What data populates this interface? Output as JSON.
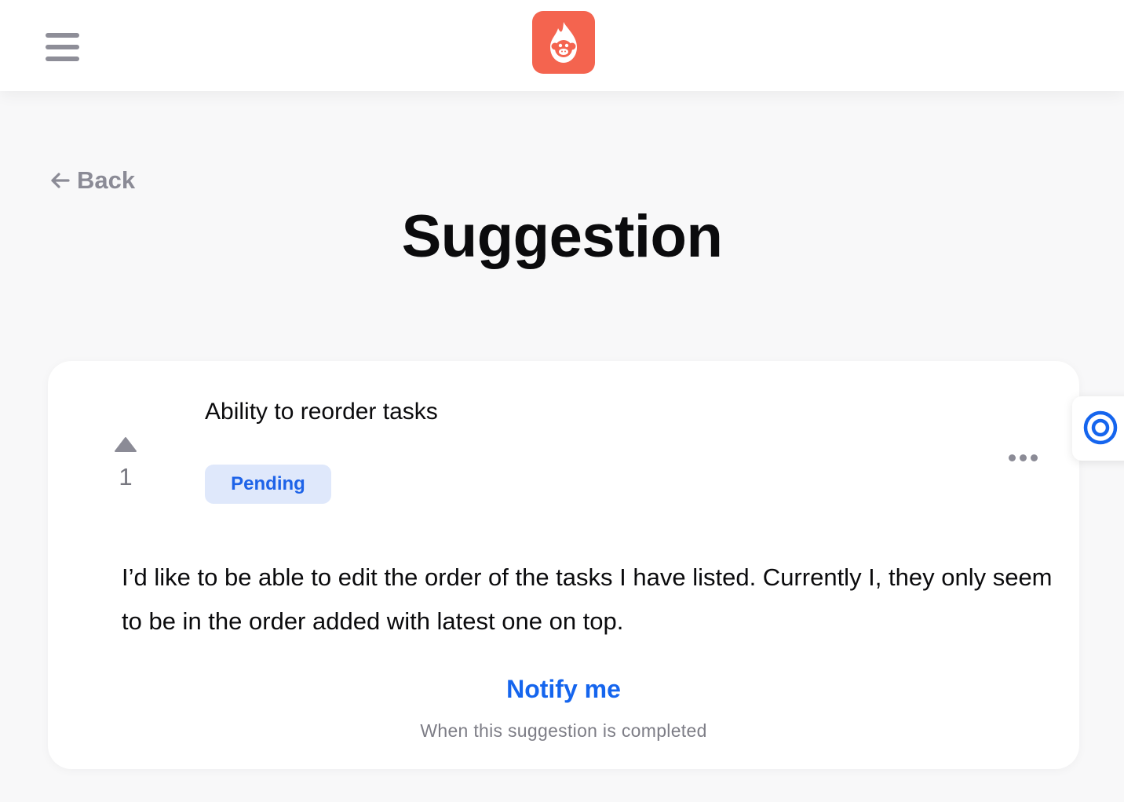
{
  "header": {
    "menu_icon": "hamburger-menu-icon",
    "logo_icon": "flame-monkey-logo",
    "brand_color": "#f4644f"
  },
  "nav": {
    "back_label": "Back",
    "back_icon": "arrow-left-icon"
  },
  "page": {
    "title": "Suggestion"
  },
  "suggestion": {
    "vote_icon": "upvote-triangle-icon",
    "vote_count": "1",
    "title": "Ability to reorder tasks",
    "status": "Pending",
    "status_color": "#1e63e8",
    "more_icon": "more-horizontal-icon",
    "description": "I’d like to be able to edit the order of the tasks I have listed. Currently I, they only seem to be in the order added with latest one on top.",
    "notify_label": "Notify me",
    "notify_subtext": "When this suggestion is completed",
    "accent_color": "#1565ee"
  },
  "side_widget": {
    "icon": "target-circle-icon"
  }
}
